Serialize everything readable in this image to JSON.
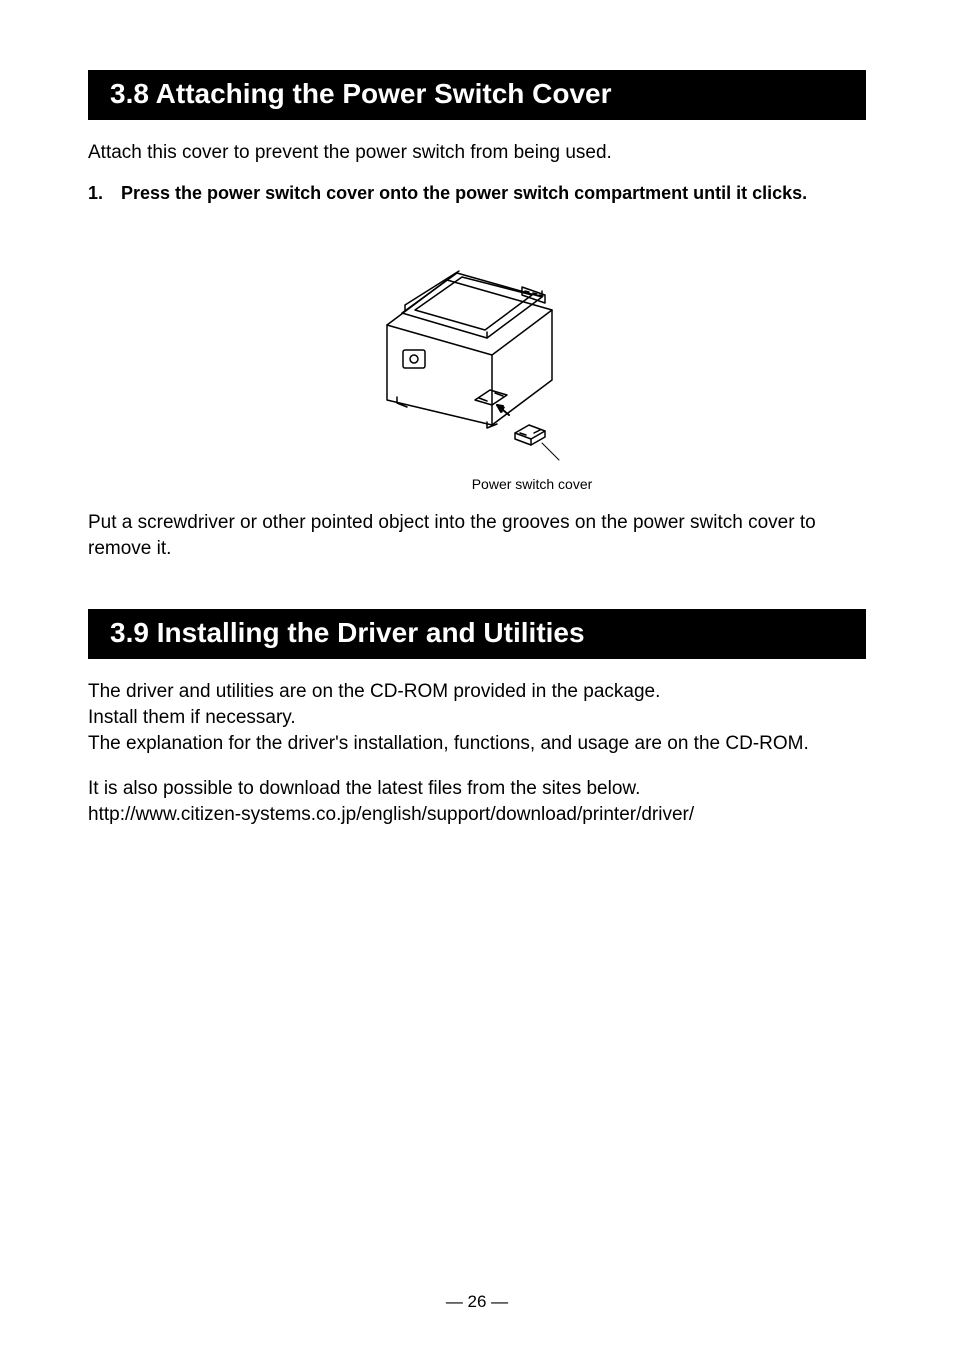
{
  "section38": {
    "heading": "3.8  Attaching the Power Switch Cover",
    "intro": "Attach this cover to prevent the power switch from being used.",
    "step_num": "1.",
    "step_text": "Press the power switch cover onto the power switch compartment until it clicks.",
    "figure_caption": "Power switch cover",
    "removal": "Put a screwdriver or other pointed object into the grooves on the power switch cover to remove it."
  },
  "section39": {
    "heading": "3.9  Installing the Driver and Utilities",
    "para1": "The driver and utilities are on the CD-ROM provided in the package.",
    "para2": "Install them if necessary.",
    "para3": "The explanation for the driver's installation, functions, and usage are on the CD-ROM.",
    "para4": "It is also possible to download the latest files from the sites below.",
    "url": "http://www.citizen-systems.co.jp/english/support/download/printer/driver/"
  },
  "page_number": "— 26 —"
}
